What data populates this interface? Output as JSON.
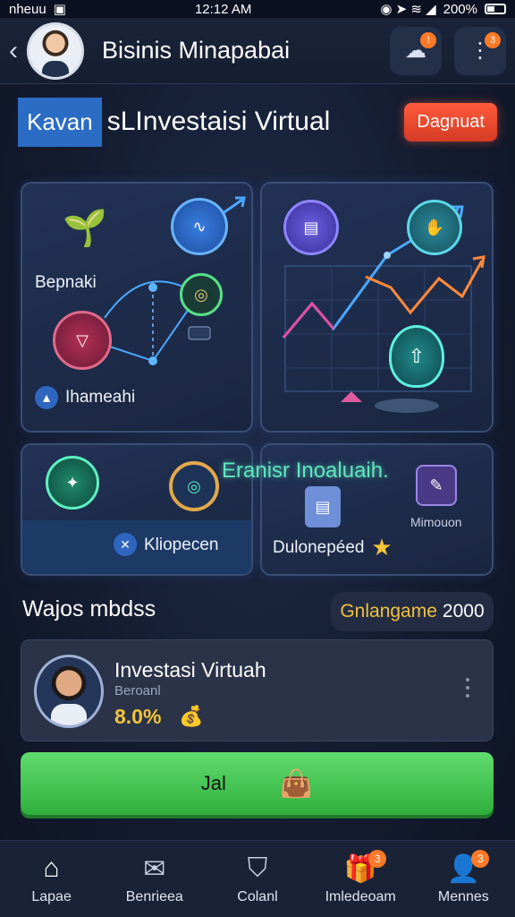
{
  "status_bar": {
    "carrier": "nheuu",
    "time": "12:12 AM",
    "battery": "200%"
  },
  "header": {
    "title": "Bisinis Minapabai"
  },
  "title_row": {
    "tag": "Kavan",
    "title": "sLInvestaisi Virtual",
    "action": "Dagnuat"
  },
  "cards": {
    "a": {
      "label_top": "Bepnaki",
      "label_bottom": "Ihameahi"
    },
    "c": {
      "label": "Kliopecen"
    },
    "d": {
      "label": "Dulonepéed",
      "overlay": "Eranisr Inoaluaih.",
      "small": "Mimouon"
    }
  },
  "section": {
    "title": "Wajos mbdss",
    "pill_label": "Gnlangame",
    "pill_value": "2000"
  },
  "list_item": {
    "title": "Investasi Virtuah",
    "subtitle": "Beroanl",
    "value": "8.0%"
  },
  "primary_button": {
    "label": "Jal"
  },
  "bottom_nav": [
    {
      "label": "Lapae",
      "icon": "home-icon",
      "badge": ""
    },
    {
      "label": "Benrieea",
      "icon": "mail-icon",
      "badge": ""
    },
    {
      "label": "Colanl",
      "icon": "shield-icon",
      "badge": ""
    },
    {
      "label": "Imledeoam",
      "icon": "gift-icon",
      "badge": "3"
    },
    {
      "label": "Mennes",
      "icon": "profile-icon",
      "badge": "3"
    }
  ],
  "colors": {
    "accent_green": "#2fae3d",
    "accent_red": "#d63b25",
    "accent_blue": "#2b6cc4",
    "gold": "#f3c43a"
  }
}
